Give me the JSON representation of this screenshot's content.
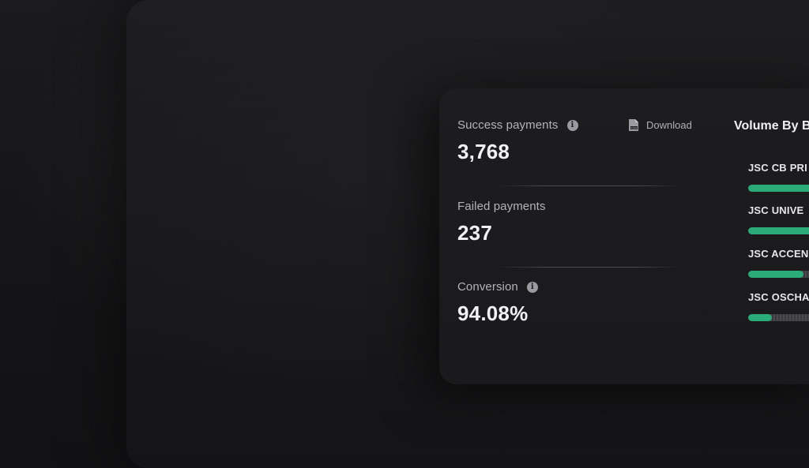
{
  "stats": {
    "success": {
      "label": "Success payments",
      "value": "3,768"
    },
    "failed": {
      "label": "Failed payments",
      "value": "237"
    },
    "conversion": {
      "label": "Conversion",
      "value": "94.08%"
    }
  },
  "download": {
    "label": "Download",
    "icon": "csv-file-icon"
  },
  "volume": {
    "title": "Volume By B",
    "banks": [
      {
        "name": "JSC CB PRI",
        "share": 1.0
      },
      {
        "name": "JSC UNIVE",
        "share": 1.0
      },
      {
        "name": "JSC ACCEN",
        "share": 0.58
      },
      {
        "name": "JSC OSCHA",
        "share": 0.25
      }
    ]
  },
  "colors": {
    "accent": "#2bab78",
    "background": "#141416",
    "card": "#1d1d20"
  }
}
